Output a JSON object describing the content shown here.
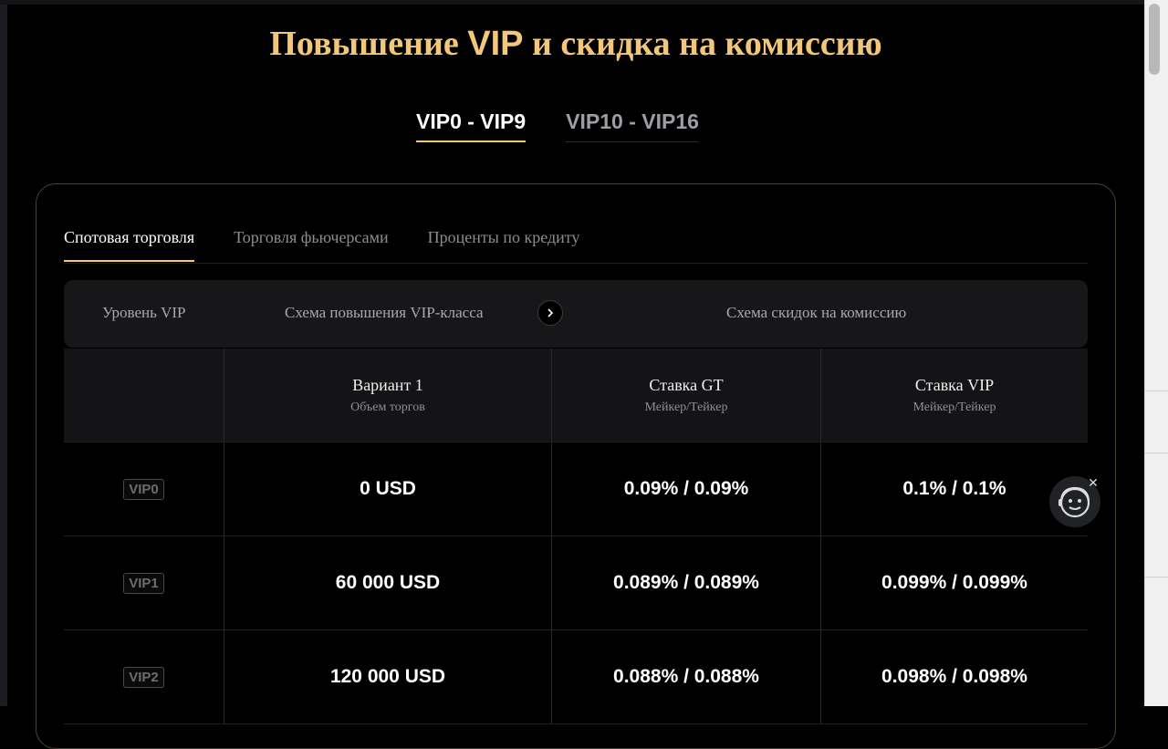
{
  "page": {
    "title_part1": "Повышение",
    "title_vip": "VIP",
    "title_part2": "и скидка на комиссию"
  },
  "range_tabs": [
    {
      "label": "VIP0 - VIP9",
      "active": true
    },
    {
      "label": "VIP10 - VIP16",
      "active": false
    }
  ],
  "category_tabs": [
    {
      "label": "Спотовая торговля",
      "active": true
    },
    {
      "label": "Торговля фьючерсами",
      "active": false
    },
    {
      "label": "Проценты по кредиту",
      "active": false
    }
  ],
  "header_bar": {
    "level": "Уровень VIP",
    "upgrade_scheme": "Схема повышения VIP-класса",
    "discount_scheme": "Схема скидок на комиссию",
    "next_icon": "chevron-right-icon"
  },
  "table": {
    "columns": [
      {
        "title": "",
        "sub": ""
      },
      {
        "title": "Вариант 1",
        "sub": "Объем торгов"
      },
      {
        "title": "Ставка GT",
        "sub": "Мейкер/Тейкер"
      },
      {
        "title": "Ставка VIP",
        "sub": "Мейкер/Тейкер"
      }
    ],
    "rows": [
      {
        "level": "VIP0",
        "volume": "0 USD",
        "gt_rate": "0.09% / 0.09%",
        "vip_rate": "0.1% / 0.1%"
      },
      {
        "level": "VIP1",
        "volume": "60 000 USD",
        "gt_rate": "0.089% / 0.089%",
        "vip_rate": "0.099% / 0.099%"
      },
      {
        "level": "VIP2",
        "volume": "120 000 USD",
        "gt_rate": "0.088% / 0.088%",
        "vip_rate": "0.098% / 0.098%"
      }
    ]
  },
  "assistant": {
    "icon": "support-robot-icon",
    "close_icon": "close-icon",
    "close_glyph": "✕"
  },
  "colors": {
    "accent": "#f2c77a",
    "background": "#000000",
    "panel": "#17171a"
  }
}
